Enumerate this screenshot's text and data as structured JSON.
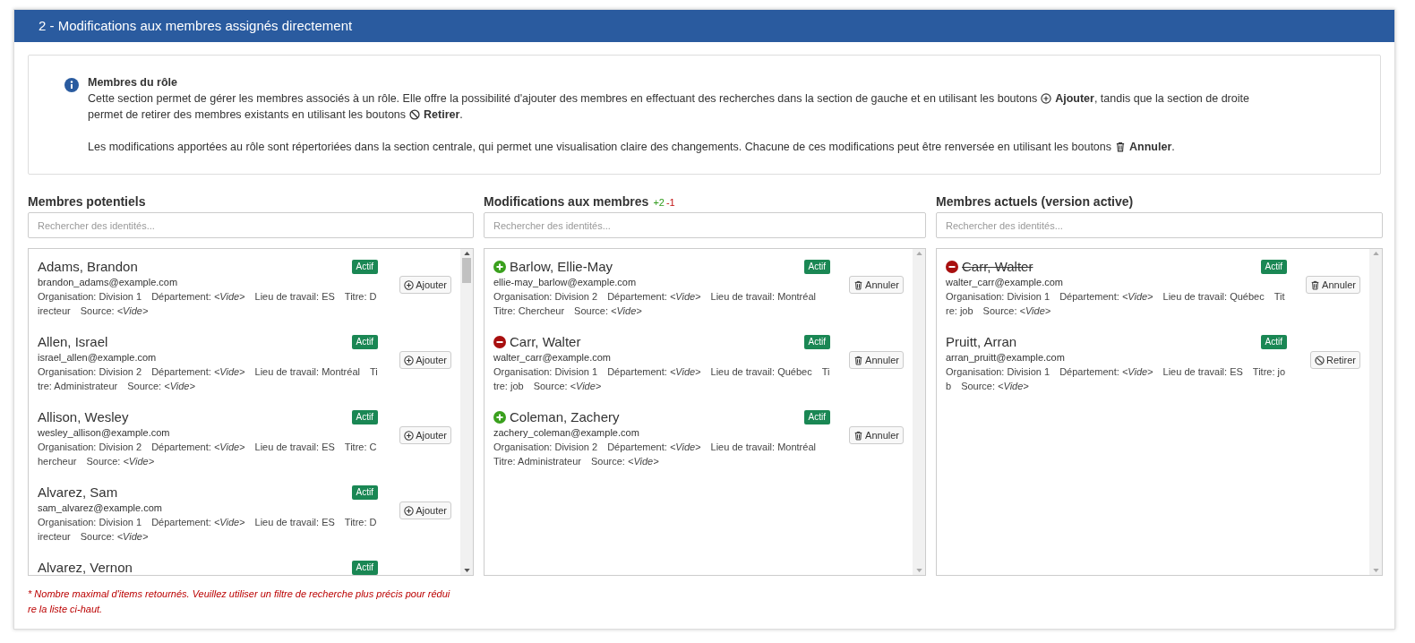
{
  "section": {
    "title": "2 - Modifications aux membres assignés directement"
  },
  "info": {
    "title": "Membres du rôle",
    "paragraph_1": [
      "Cette section permet de gérer les membres associés à un rôle. Elle offre la possibilité d'ajouter des membres en effectuant des recherches dans la section de gauche et en utilisant les boutons",
      "**Ajouter**, tandis que la section de droite",
      "permet de retirer des membres existants en utilisant les boutons",
      "**Retirer**."
    ],
    "paragraph_2": [
      "Les modifications apportées au rôle sont répertoriées dans la section centrale, qui permet une visualisation claire des changements. Chacune de ces modifications peut être renversée en utilisant les boutons",
      "**Annuler**."
    ]
  },
  "columns": [
    {
      "title": "Membres potentiels",
      "search": {
        "placeholder": "Rechercher des identités..."
      },
      "scroll_thumb": true,
      "members": [
        {
          "name": "Adams, Brandon",
          "status": "Actif",
          "email": "brandon_adams@example.com",
          "details": [
            "Organisation: Division 1",
            "Département: *<Vide>*",
            "Lieu de travail: ES",
            "Titre: Directeur",
            "Source: *<Vide>*"
          ],
          "button": {
            "kind": "add",
            "label": "Ajouter"
          }
        },
        {
          "name": "Allen, Israel",
          "status": "Actif",
          "email": "israel_allen@example.com",
          "details": [
            "Organisation: Division 2",
            "Département: *<Vide>*",
            "Lieu de travail: Montréal",
            "Titre: Administrateur",
            "Source: *<Vide>*"
          ],
          "button": {
            "kind": "add",
            "label": "Ajouter"
          }
        },
        {
          "name": "Allison, Wesley",
          "status": "Actif",
          "email": "wesley_allison@example.com",
          "details": [
            "Organisation: Division 2",
            "Département: *<Vide>*",
            "Lieu de travail: ES",
            "Titre: Chercheur",
            "Source: *<Vide>*"
          ],
          "button": {
            "kind": "add",
            "label": "Ajouter"
          }
        },
        {
          "name": "Alvarez, Sam",
          "status": "Actif",
          "email": "sam_alvarez@example.com",
          "details": [
            "Organisation: Division 1",
            "Département: *<Vide>*",
            "Lieu de travail: ES",
            "Titre: Directeur",
            "Source: *<Vide>*"
          ],
          "button": {
            "kind": "add",
            "label": "Ajouter"
          }
        },
        {
          "name": "Alvarez, Vernon",
          "status": "Actif"
        }
      ],
      "footnote": "* Nombre maximal d'items retournés. Veuillez utiliser un filtre de recherche plus précis pour réduire la liste ci-haut."
    },
    {
      "title": "Modifications aux membres",
      "added": "+2",
      "removed": "-1",
      "search": {
        "placeholder": "Rechercher des identités..."
      },
      "scroll_thumb": false,
      "members": [
        {
          "kind": "added",
          "name": "Barlow, Ellie-May",
          "status": "Actif",
          "email": "ellie-may_barlow@example.com",
          "details": [
            "Organisation: Division 2",
            "Département: *<Vide>*",
            "Lieu de travail: Montréal",
            "Titre: Chercheur",
            "Source: *<Vide>*"
          ],
          "button": {
            "kind": "undo",
            "label": "Annuler"
          }
        },
        {
          "kind": "removed",
          "name": "Carr, Walter",
          "status": "Actif",
          "email": "walter_carr@example.com",
          "details": [
            "Organisation: Division 1",
            "Département: *<Vide>*",
            "Lieu de travail: Québec",
            "Titre: job",
            "Source: *<Vide>*"
          ],
          "button": {
            "kind": "undo",
            "label": "Annuler"
          }
        },
        {
          "kind": "added",
          "name": "Coleman, Zachery",
          "status": "Actif",
          "email": "zachery_coleman@example.com",
          "details": [
            "Organisation: Division 2",
            "Département: *<Vide>*",
            "Lieu de travail: Montréal",
            "Titre: Administrateur",
            "Source: *<Vide>*"
          ],
          "button": {
            "kind": "undo",
            "label": "Annuler"
          }
        }
      ]
    },
    {
      "title": "Membres actuels (version active)",
      "search": {
        "placeholder": "Rechercher des identités..."
      },
      "scroll_thumb": false,
      "members": [
        {
          "kind": "removed",
          "struck": true,
          "name": "Carr, Walter",
          "status": "Actif",
          "email": "walter_carr@example.com",
          "details": [
            "Organisation: Division 1",
            "Département: *<Vide>*",
            "Lieu de travail: Québec",
            "Titre: job",
            "Source: *<Vide>*"
          ],
          "button": {
            "kind": "undo",
            "label": "Annuler"
          }
        },
        {
          "name": "Pruitt, Arran",
          "status": "Actif",
          "email": "arran_pruitt@example.com",
          "details": [
            "Organisation: Division 1",
            "Département: *<Vide>*",
            "Lieu de travail: ES",
            "Titre: job",
            "Source: *<Vide>*"
          ],
          "button": {
            "kind": "remove",
            "label": "Retirer"
          }
        }
      ]
    }
  ]
}
